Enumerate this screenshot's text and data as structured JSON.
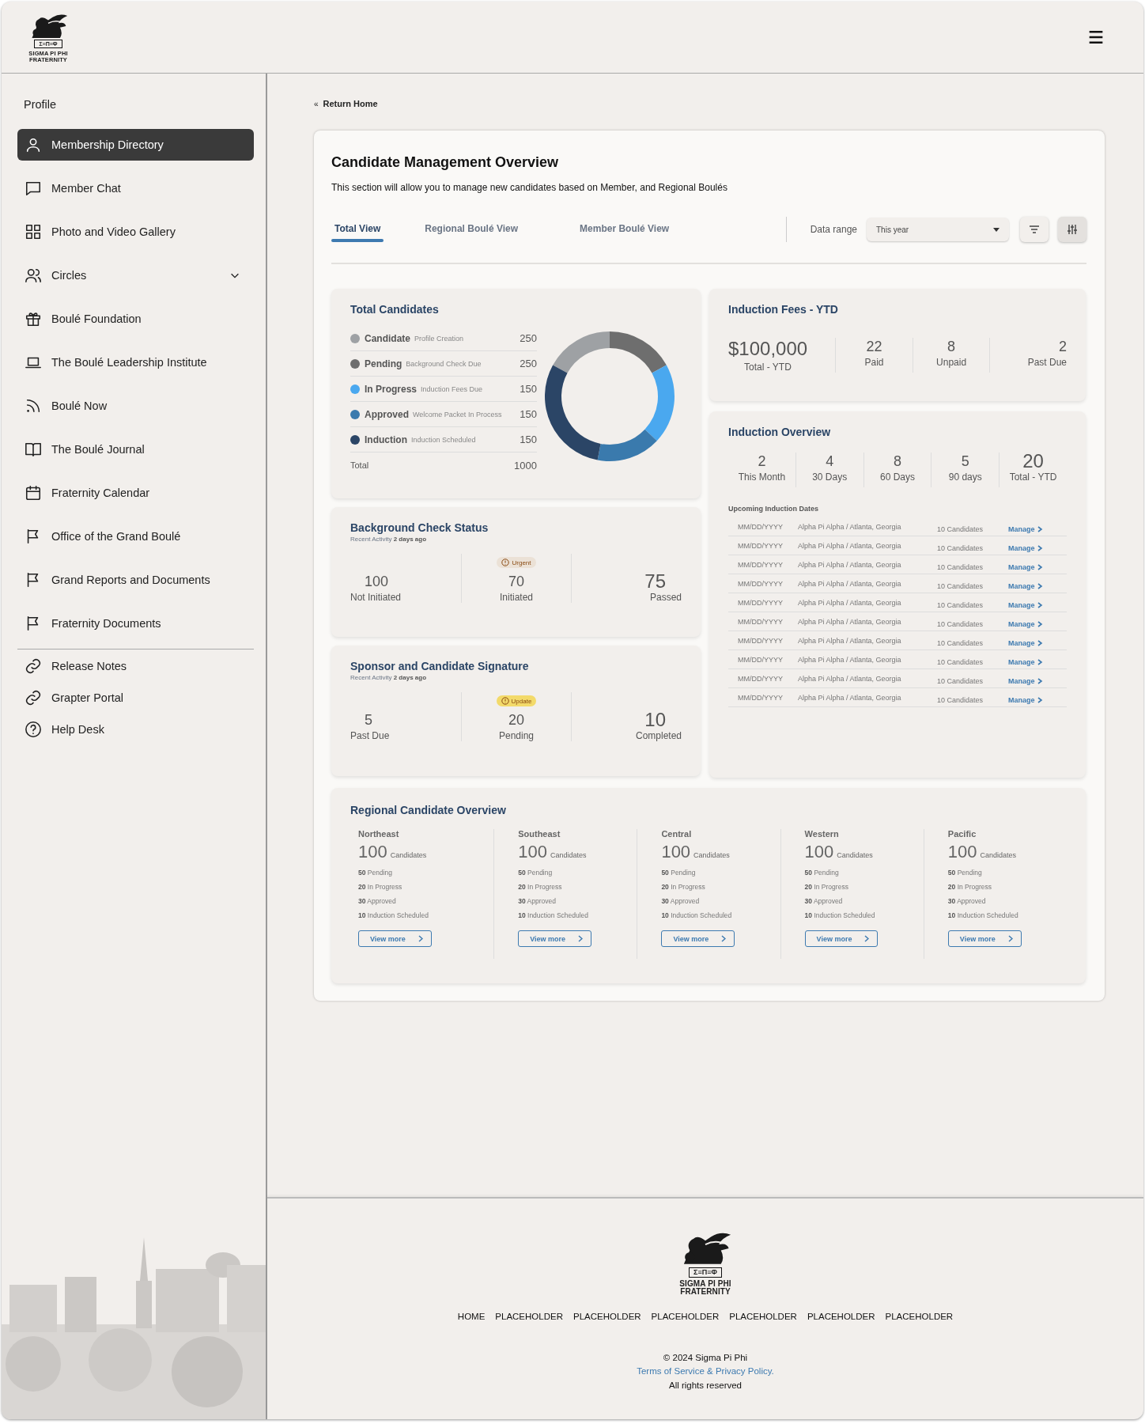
{
  "header": {
    "logo": {
      "letters": "Σ≡Π≡Φ",
      "name": "SIGMA PI PHI",
      "subtitle": "FRATERNITY"
    }
  },
  "sidebar": {
    "profile": "Profile",
    "items": [
      {
        "label": "Membership Directory",
        "kind": "link",
        "selected": true
      },
      {
        "label": "Member Chat",
        "kind": "link",
        "selected": false
      },
      {
        "label": "Photo  and Video Gallery",
        "kind": "link",
        "selected": false
      },
      {
        "label": "Circles",
        "kind": "group",
        "expanded": false,
        "selected": false
      },
      {
        "label": "Boulé Foundation",
        "kind": "link",
        "selected": false
      },
      {
        "label": "The Boulé Leadership Institute",
        "kind": "link",
        "selected": false
      },
      {
        "label": "Boulé Now",
        "kind": "link",
        "selected": false
      },
      {
        "label": "The Boulé Journal",
        "kind": "link",
        "selected": false
      },
      {
        "label": "Fraternity Calendar",
        "kind": "link",
        "selected": false
      },
      {
        "label": "Office of the Grand Boulé",
        "kind": "link",
        "selected": false
      },
      {
        "label": "Grand Reports and Documents",
        "kind": "link",
        "selected": false
      },
      {
        "label": "Fraternity Documents",
        "kind": "link",
        "selected": false
      }
    ],
    "links": [
      "Release Notes",
      "Grapter Portal",
      "Help Desk"
    ]
  },
  "breadcrumb": {
    "icon": "«",
    "label": "Return Home"
  },
  "overview": {
    "title": "Candidate Management Overview",
    "description": "This section will allow you to manage new candidates based on Member, and Regional Boulés",
    "tabs": [
      {
        "label": "Total View",
        "selected": true
      },
      {
        "label": "Regional Boulé View",
        "selected": false
      },
      {
        "label": "Member Boulé View",
        "selected": false
      }
    ],
    "data_range": {
      "label": "Data range",
      "value": "This year"
    }
  },
  "total_candidates": {
    "title": "Total Candidates",
    "rows": [
      {
        "note": "Profile Creation",
        "value": "250",
        "color": "#9ea1a4"
      },
      {
        "note": "Background Check Due",
        "value": "250",
        "color": "#6e6e6e"
      },
      {
        "note": "Induction Fees Due",
        "value": "150",
        "color": "#4aa8ef"
      },
      {
        "note": "Welcome Packet In Process",
        "value": "150",
        "color": "#3a7aad"
      },
      {
        "note": "Induction Scheduled",
        "value": "150",
        "color": "#2b4566"
      }
    ],
    "total_label": "Total",
    "total_value": "1000",
    "chart_data": {
      "type": "donut",
      "categories": [
        "Candidate",
        "Pending",
        "In Progress",
        "Approved",
        "Induction"
      ],
      "values": [
        17,
        17,
        20,
        16,
        30
      ]
    }
  },
  "background_check": {
    "title": "Background Check Status",
    "activity": "Recent Activity **2 days ago**",
    "stats": [
      {
        "value": "100",
        "label": "Not Initiated"
      },
      {
        "value": "70",
        "label": "Initiated",
        "badge": {
          "kind": "urgent",
          "text": "Urgent"
        }
      },
      {
        "value": "75",
        "label": "Passed"
      }
    ]
  },
  "signature": {
    "title": "Sponsor and Candidate Signature",
    "activity": "Recent Activity **2 days ago**",
    "stats": [
      {
        "value": "5",
        "label": "Past Due"
      },
      {
        "value": "20",
        "label": "Pending",
        "badge": {
          "kind": "update",
          "text": "Update"
        }
      },
      {
        "value": "10",
        "label": "Completed"
      }
    ]
  },
  "fees": {
    "title": "Induction Fees - YTD",
    "stats": [
      {
        "value": "$100,000",
        "label": "Total - YTD"
      },
      {
        "value": "22",
        "label": "Paid"
      },
      {
        "value": "8",
        "label": "Unpaid"
      },
      {
        "value": "2",
        "label": "Past Due"
      }
    ]
  },
  "induction": {
    "title": "Induction Overview",
    "stats": [
      {
        "value": "2",
        "label": "This Month"
      },
      {
        "value": "4",
        "label": "30 Days"
      },
      {
        "value": "8",
        "label": "60 Days"
      },
      {
        "value": "5",
        "label": "90 days"
      },
      {
        "value": "20",
        "label": "Total - YTD"
      }
    ],
    "upcoming_title": "Upcoming Induction Dates",
    "rows": [
      {
        "date": "MM/DD/YYYY",
        "place": "Alpha Pi Alpha  /  Atlanta, Georgia",
        "count": "10 Candidates",
        "action": "Manage"
      },
      {
        "date": "MM/DD/YYYY",
        "place": "Alpha Pi Alpha  /  Atlanta, Georgia",
        "count": "10 Candidates",
        "action": "Manage"
      },
      {
        "date": "MM/DD/YYYY",
        "place": "Alpha Pi Alpha  /  Atlanta, Georgia",
        "count": "10 Candidates",
        "action": "Manage"
      },
      {
        "date": "MM/DD/YYYY",
        "place": "Alpha Pi Alpha  /  Atlanta, Georgia",
        "count": "10 Candidates",
        "action": "Manage"
      },
      {
        "date": "MM/DD/YYYY",
        "place": "Alpha Pi Alpha  /  Atlanta, Georgia",
        "count": "10 Candidates",
        "action": "Manage"
      },
      {
        "date": "MM/DD/YYYY",
        "place": "Alpha Pi Alpha  /  Atlanta, Georgia",
        "count": "10 Candidates",
        "action": "Manage"
      },
      {
        "date": "MM/DD/YYYY",
        "place": "Alpha Pi Alpha  /  Atlanta, Georgia",
        "count": "10 Candidates",
        "action": "Manage"
      },
      {
        "date": "MM/DD/YYYY",
        "place": "Alpha Pi Alpha  /  Atlanta, Georgia",
        "count": "10 Candidates",
        "action": "Manage"
      },
      {
        "date": "MM/DD/YYYY",
        "place": "Alpha Pi Alpha  /  Atlanta, Georgia",
        "count": "10 Candidates",
        "action": "Manage"
      },
      {
        "date": "MM/DD/YYYY",
        "place": "Alpha Pi Alpha  /  Atlanta, Georgia",
        "count": "10 Candidates",
        "action": "Manage"
      }
    ]
  },
  "regional": {
    "title": "Regional Candidate Overview",
    "regions": [
      {
        "name": "Northeast",
        "total": "100",
        "unit": "Candidates",
        "lines": [
          "**50** Pending",
          "**20** In Progress",
          "**30** Approved",
          "**10** Induction Scheduled"
        ],
        "button": "View more"
      },
      {
        "name": "Southeast",
        "total": "100",
        "unit": "Candidates",
        "lines": [
          "**50** Pending",
          "**20** In Progress",
          "**30** Approved",
          "**10** Induction Scheduled"
        ],
        "button": "View more"
      },
      {
        "name": "Central",
        "total": "100",
        "unit": "Candidates",
        "lines": [
          "**50** Pending",
          "**20** In Progress",
          "**30** Approved",
          "**10** Induction Scheduled"
        ],
        "button": "View more"
      },
      {
        "name": "Western",
        "total": "100",
        "unit": "Candidates",
        "lines": [
          "**50** Pending",
          "**20** In Progress",
          "**30** Approved",
          "**10** Induction Scheduled"
        ],
        "button": "View more"
      },
      {
        "name": "Pacific",
        "total": "100",
        "unit": "Candidates",
        "lines": [
          "**50** Pending",
          "**20** In Progress",
          "**30** Approved",
          "**10** Induction Scheduled"
        ],
        "button": "View more"
      }
    ]
  },
  "footer": {
    "logo": {
      "letters": "Σ≡Π≡Φ",
      "name": "SIGMA PI PHI",
      "subtitle": "FRATERNITY"
    },
    "nav": [
      "HOME",
      "PLACEHOLDER",
      "PLACEHOLDER",
      "PLACEHOLDER",
      "PLACEHOLDER",
      "PLACEHOLDER",
      "PLACEHOLDER"
    ],
    "copyright": "© 2024 Sigma Pi Phi",
    "terms": "Terms of Service & Privacy Policy.",
    "rights": "All rights reserved"
  }
}
